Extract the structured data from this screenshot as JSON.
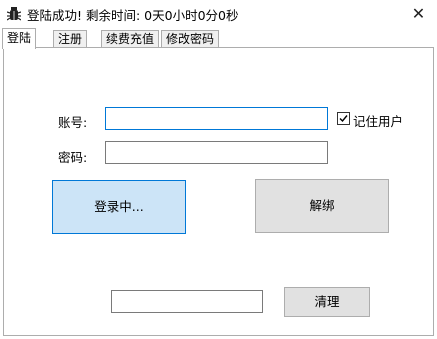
{
  "window": {
    "title": "登陆成功! 剩余时间: 0天0小时0分0秒",
    "close_glyph": "✕"
  },
  "tabs": [
    {
      "label": "登陆",
      "active": true
    },
    {
      "label": "注册",
      "active": false
    },
    {
      "label": "续费充值",
      "active": false
    },
    {
      "label": "修改密码",
      "active": false
    }
  ],
  "login": {
    "account_label": "账号:",
    "account_value": "",
    "password_label": "密码:",
    "password_value": "",
    "remember_label": "记住用户",
    "remember_checked": true,
    "login_button": "登录中...",
    "unbind_button": "解绑",
    "clear_input_value": "",
    "clear_button": "清理"
  },
  "colors": {
    "primary_button_bg": "#cce4f7",
    "primary_button_border": "#0078d7",
    "button_bg": "#e1e1e1",
    "focus_border": "#0078d7"
  }
}
